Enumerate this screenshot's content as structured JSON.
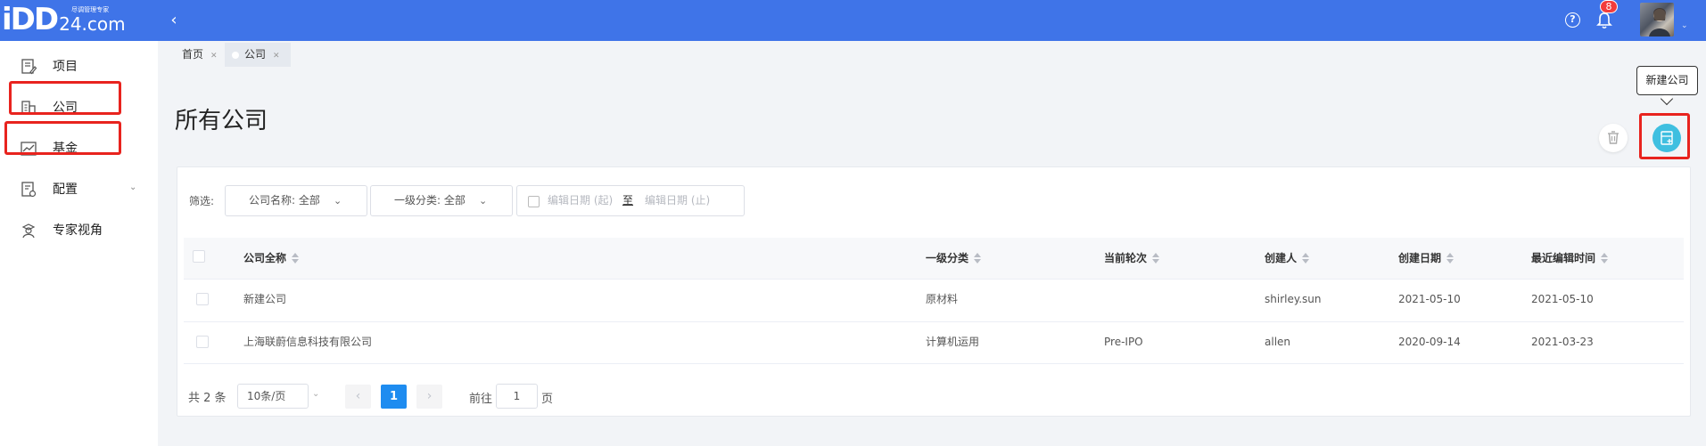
{
  "brand": {
    "logo_main": "iDD",
    "logo_sub": "尽调管理专家",
    "logo_domain": "24.com"
  },
  "header": {
    "notification_count": "8",
    "collapse_icon": "chevron-left-icon",
    "help_icon": "question-circle-icon",
    "bell_icon": "bell-icon"
  },
  "sidebar": {
    "items": [
      {
        "label": "项目",
        "icon": "document-edit-icon"
      },
      {
        "label": "公司",
        "icon": "building-icon"
      },
      {
        "label": "基金",
        "icon": "trend-chart-icon"
      },
      {
        "label": "配置",
        "icon": "settings-doc-icon"
      },
      {
        "label": "专家视角",
        "icon": "expert-icon"
      }
    ]
  },
  "tabs": [
    {
      "label": "首页",
      "active": false
    },
    {
      "label": "公司",
      "active": true
    }
  ],
  "page": {
    "title": "所有公司",
    "add_tooltip": "新建公司"
  },
  "filters": {
    "label": "筛选:",
    "company_name": "公司名称: 全部",
    "category": "一级分类: 全部",
    "date_start_placeholder": "编辑日期 (起)",
    "date_separator": "至",
    "date_end_placeholder": "编辑日期 (止)"
  },
  "table": {
    "columns": [
      "公司全称",
      "一级分类",
      "当前轮次",
      "创建人",
      "创建日期",
      "最近编辑时间"
    ],
    "rows": [
      {
        "name": "新建公司",
        "category": "原材料",
        "round": "",
        "creator": "shirley.sun",
        "created": "2021-05-10",
        "edited": "2021-05-10"
      },
      {
        "name": "上海联蔚信息科技有限公司",
        "category": "计算机运用",
        "round": "Pre-IPO",
        "creator": "allen",
        "created": "2020-09-14",
        "edited": "2021-03-23"
      }
    ]
  },
  "pagination": {
    "total": "共 2 条",
    "page_size": "10条/页",
    "current_page": "1",
    "goto_label": "前往",
    "goto_value": "1",
    "page_suffix": "页",
    "prev": "‹",
    "next": "›"
  },
  "colors": {
    "header_bg": "#3f74e8",
    "accent": "#1e8cf0",
    "add_button": "#3fbfe0",
    "highlight_box": "#e8231e"
  }
}
